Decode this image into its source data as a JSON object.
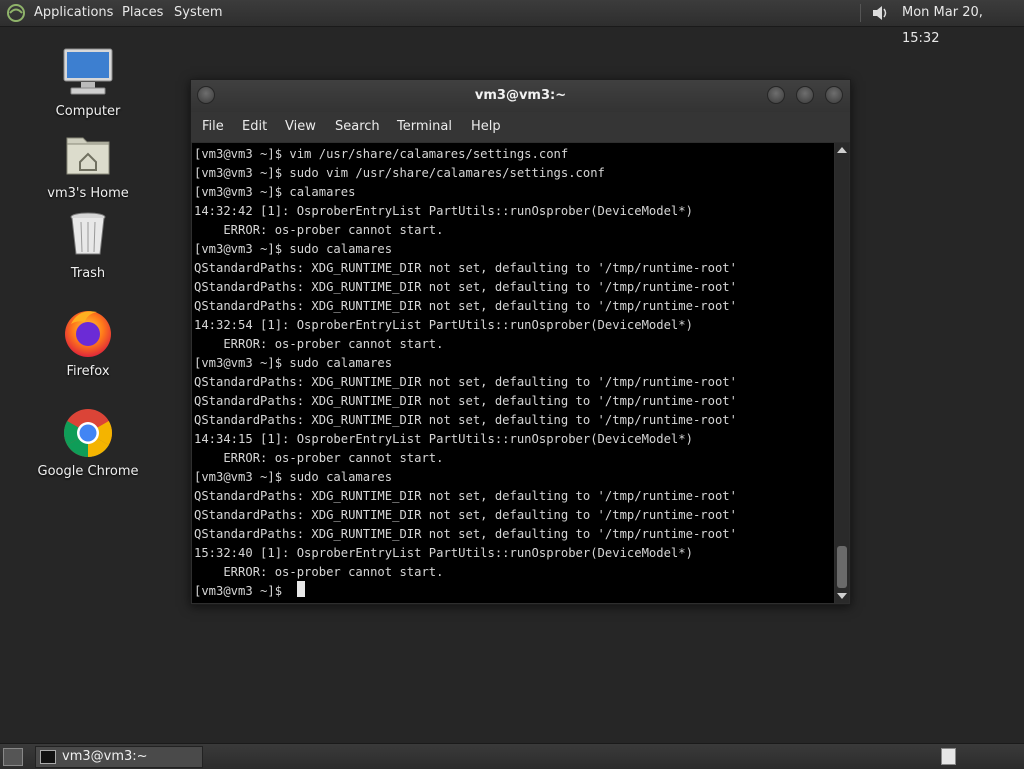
{
  "top_panel": {
    "menus": [
      "Applications",
      "Places",
      "System"
    ],
    "clock": "Mon Mar 20, 15:32",
    "logo_icon": "distro-logo-icon",
    "volume_icon": "volume-icon"
  },
  "desktop": {
    "icons": [
      {
        "label": "Computer",
        "icon": "computer-icon"
      },
      {
        "label": "vm3's Home",
        "icon": "home-folder-icon"
      },
      {
        "label": "Trash",
        "icon": "trash-icon"
      },
      {
        "label": "Firefox",
        "icon": "firefox-icon"
      },
      {
        "label": "Google Chrome",
        "icon": "chrome-icon"
      }
    ]
  },
  "window": {
    "title": "vm3@vm3:~",
    "menu": [
      "File",
      "Edit",
      "View",
      "Search",
      "Terminal",
      "Help"
    ],
    "terminal_lines": [
      "[vm3@vm3 ~]$ vim /usr/share/calamares/settings.conf",
      "[vm3@vm3 ~]$ sudo vim /usr/share/calamares/settings.conf",
      "[vm3@vm3 ~]$ calamares",
      "14:32:42 [1]: OsproberEntryList PartUtils::runOsprober(DeviceModel*)",
      "    ERROR: os-prober cannot start.",
      "[vm3@vm3 ~]$ sudo calamares",
      "QStandardPaths: XDG_RUNTIME_DIR not set, defaulting to '/tmp/runtime-root'",
      "QStandardPaths: XDG_RUNTIME_DIR not set, defaulting to '/tmp/runtime-root'",
      "QStandardPaths: XDG_RUNTIME_DIR not set, defaulting to '/tmp/runtime-root'",
      "14:32:54 [1]: OsproberEntryList PartUtils::runOsprober(DeviceModel*)",
      "    ERROR: os-prober cannot start.",
      "[vm3@vm3 ~]$ sudo calamares",
      "QStandardPaths: XDG_RUNTIME_DIR not set, defaulting to '/tmp/runtime-root'",
      "QStandardPaths: XDG_RUNTIME_DIR not set, defaulting to '/tmp/runtime-root'",
      "QStandardPaths: XDG_RUNTIME_DIR not set, defaulting to '/tmp/runtime-root'",
      "14:34:15 [1]: OsproberEntryList PartUtils::runOsprober(DeviceModel*)",
      "    ERROR: os-prober cannot start.",
      "[vm3@vm3 ~]$ sudo calamares",
      "QStandardPaths: XDG_RUNTIME_DIR not set, defaulting to '/tmp/runtime-root'",
      "QStandardPaths: XDG_RUNTIME_DIR not set, defaulting to '/tmp/runtime-root'",
      "QStandardPaths: XDG_RUNTIME_DIR not set, defaulting to '/tmp/runtime-root'",
      "15:32:40 [1]: OsproberEntryList PartUtils::runOsprober(DeviceModel*)",
      "    ERROR: os-prober cannot start.",
      "[vm3@vm3 ~]$ "
    ]
  },
  "bottom_panel": {
    "task_label": "vm3@vm3:~",
    "show_desktop_icon": "show-desktop-icon",
    "workspace_icon": "workspace-switcher-icon"
  }
}
